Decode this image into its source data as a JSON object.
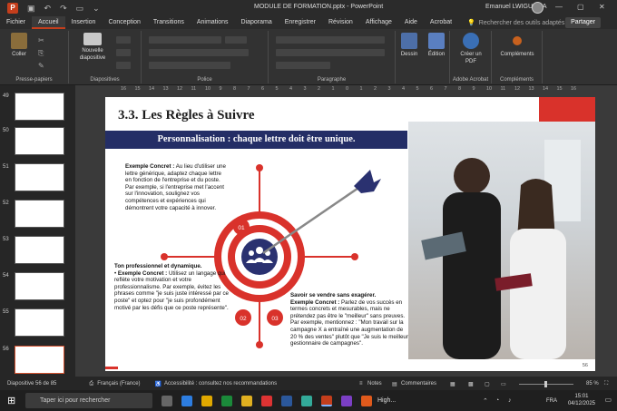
{
  "titlebar": {
    "doc_name": "MODULE DE FORMATION.pptx  -  PowerPoint",
    "user": "Emanuel LWIGULIRA"
  },
  "tabs": [
    "Fichier",
    "Accueil",
    "Insertion",
    "Conception",
    "Transitions",
    "Animations",
    "Diaporama",
    "Enregistrer",
    "Révision",
    "Affichage",
    "Aide",
    "Acrobat"
  ],
  "search_placeholder": "Rechercher des outils adaptés",
  "share_label": "Partager",
  "ribbon": {
    "paste_label": "Coller",
    "group_clipboard": "Presse-papiers",
    "new_slide_label": "Nouvelle diapositive",
    "group_slides": "Diapositives",
    "group_font": "Police",
    "group_paragraph": "Paragraphe",
    "draw_label": "Dessin",
    "edit_label": "Édition",
    "create_pdf_label": "Créer un PDF",
    "group_acrobat": "Adobe Acrobat",
    "addins_label": "Compléments",
    "group_addins": "Compléments"
  },
  "ruler_ticks": [
    "16",
    "15",
    "14",
    "13",
    "12",
    "11",
    "10",
    "9",
    "8",
    "7",
    "6",
    "5",
    "4",
    "3",
    "2",
    "1",
    "0",
    "1",
    "2",
    "3",
    "4",
    "5",
    "6",
    "7",
    "8",
    "9",
    "10",
    "11",
    "12",
    "13",
    "14",
    "15",
    "16"
  ],
  "thumbnails": [
    "49",
    "50",
    "51",
    "52",
    "53",
    "54",
    "55",
    "56"
  ],
  "slide": {
    "title": "3.3. Les Règles à Suivre",
    "banner": "Personnalisation : chaque lettre doit être unique.",
    "ex1_label": "Exemple Concret :",
    "ex1_text": " Au lieu d'utiliser une lettre générique, adaptez chaque lettre en fonction de l'entreprise et du poste. Par exemple, si l'entreprise met l'accent sur l'innovation, soulignez vos compétences et expériences qui démontrent votre capacité à innover.",
    "tone_heading": "Ton professionnel et dynamique.",
    "ex2_label": "Exemple Concret :",
    "ex2_text": " Utilisez un langage qui reflète votre motivation et votre professionnalisme. Par exemple, évitez les phrases comme \"je suis juste intéressé par ce poste\" et optez pour \"je suis profondément motivé par les défis que ce poste représente\".",
    "sell_heading": "Savoir se vendre sans exagérer.",
    "ex3_label": "Exemple Concret :",
    "ex3_text": " Parlez de vos succès en termes concrets et mesurables, mais ne prétendez pas être le \"meilleur\" sans preuves. Par exemple, mentionnez : \"Mon travail sur la campagne X a entraîné une augmentation de 20 % des ventes\" plutôt que \"Je suis le meilleur gestionnaire de campagnes\".",
    "badge1": "01",
    "badge2": "02",
    "badge3": "03",
    "page_number": "56"
  },
  "status": {
    "slide_info": "Diapositive 56 de 85",
    "language": "Français (France)",
    "accessibility": "Accessibilité : consultez nos recommandations",
    "notes": "Notes",
    "comments": "Commentaires",
    "zoom": "85 %"
  },
  "taskbar": {
    "search_placeholder": "Taper ici pour rechercher",
    "weather": "High...",
    "lang": "FRA",
    "time": "15:01",
    "date": "04/12/2025"
  },
  "colors": {
    "accent": "#d35230",
    "banner": "#242e66",
    "target_red": "#d9322b",
    "arrow_navy": "#2a3170"
  }
}
